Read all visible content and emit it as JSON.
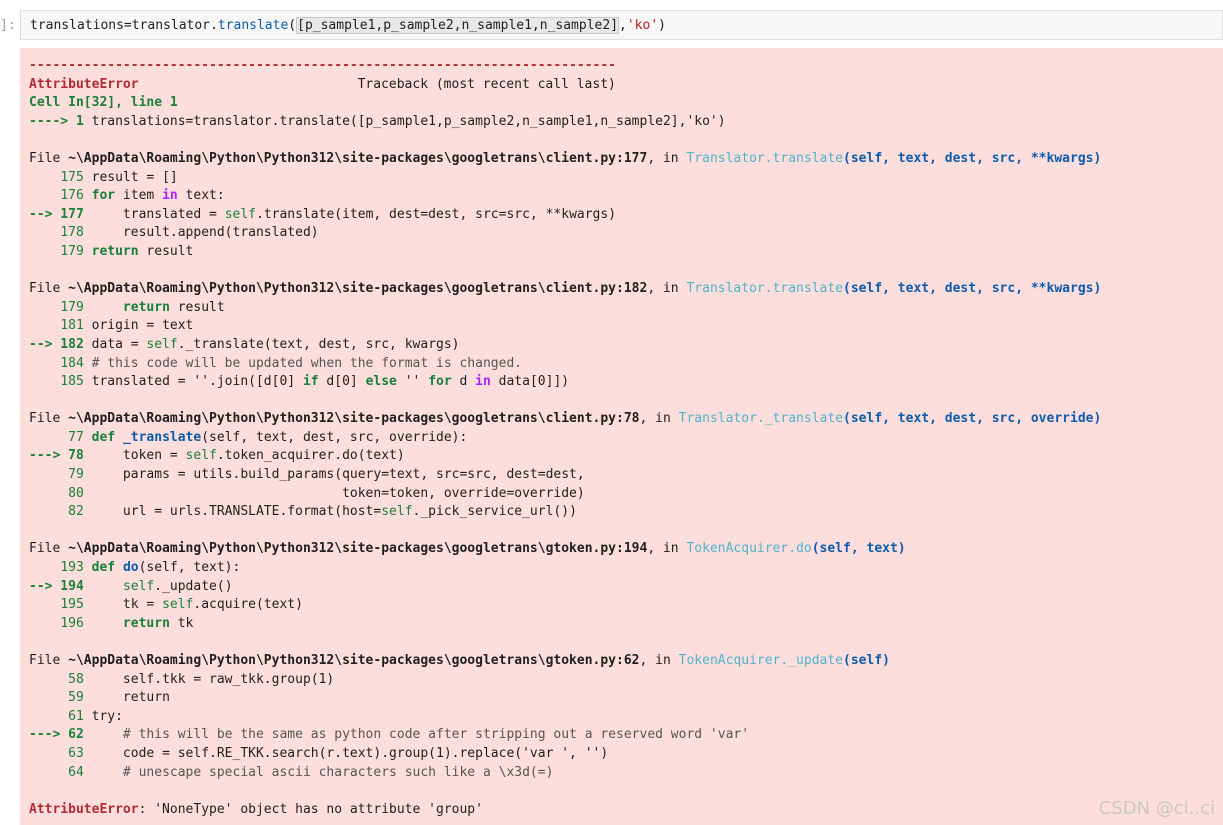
{
  "prompt": "]:",
  "input": {
    "prefix": "translations=translator.",
    "method": "translate",
    "open": "(",
    "highlighted_list": "[p_sample1,p_sample2,n_sample1,n_sample2]",
    "sep": ",",
    "arg": "'ko'",
    "close": ")"
  },
  "traceback": {
    "dashes": "---------------------------------------------------------------------------",
    "error_name": "AttributeError",
    "header_right": "Traceback (most recent call last)",
    "cell_prefix": "Cell ",
    "cell_ref": "In[32], line 1",
    "first_arrow": "----> 1 ",
    "first_code": "translations=translator.translate([p_sample1,p_sample2,n_sample1,n_sample2],'ko')",
    "frames": [
      {
        "file": "~\\AppData\\Roaming\\Python\\Python312\\site-packages\\googletrans\\client.py:177",
        "in_text": ", in ",
        "func": "Translator.translate",
        "args": "(self, text, dest, src, **kwargs)",
        "lines": [
          {
            "num": "175",
            "code": "result = []"
          },
          {
            "num": "176",
            "kw": "for",
            "code": " item ",
            "kw2": "in",
            "code2": " text:"
          },
          {
            "arrow": "--> 177",
            "code": "    translated = ",
            "self": "self",
            "code2": ".translate(item, dest=dest, src=src, **kwargs)"
          },
          {
            "num": "178",
            "code": "    result.append(translated)"
          },
          {
            "num": "179",
            "kw": "return",
            "code": " result"
          }
        ]
      },
      {
        "file": "~\\AppData\\Roaming\\Python\\Python312\\site-packages\\googletrans\\client.py:182",
        "in_text": ", in ",
        "func": "Translator.translate",
        "args": "(self, text, dest, src, **kwargs)",
        "lines": [
          {
            "num": "179",
            "kw": "    return",
            "code": " result"
          },
          {
            "num": "181",
            "code": "origin = text"
          },
          {
            "arrow": "--> 182",
            "code": "data = ",
            "self": "self",
            "code2": "._translate(text, dest, src, kwargs)"
          },
          {
            "num": "184",
            "comment": "# this code will be updated when the format is changed."
          },
          {
            "num": "185",
            "code": "translated = ''.join([d[0] ",
            "kw": "if",
            "code2": " d[0] ",
            "kw2": "else",
            "code3": " '' ",
            "kw3": "for",
            "code4": " d ",
            "kw4": "in",
            "code5": " data[0]])"
          }
        ]
      },
      {
        "file": "~\\AppData\\Roaming\\Python\\Python312\\site-packages\\googletrans\\client.py:78",
        "in_text": ", in ",
        "func": "Translator._translate",
        "args": "(self, text, dest, src, override)",
        "lines": [
          {
            "num": "77",
            "kw": "def",
            "sp": " ",
            "fn": "_translate",
            "code": "(self, text, dest, src, override):"
          },
          {
            "arrow": "---> 78",
            "code": "    token = ",
            "self": "self",
            "code2": ".token_acquirer.do(text)"
          },
          {
            "num": "79",
            "code": "    params = utils.build_params(query=text, src=src, dest=dest,"
          },
          {
            "num": "80",
            "code": "                                token=token, override=override)"
          },
          {
            "num": "82",
            "code": "    url = urls.TRANSLATE.format(host=",
            "self": "self",
            "code2": "._pick_service_url())"
          }
        ]
      },
      {
        "file": "~\\AppData\\Roaming\\Python\\Python312\\site-packages\\googletrans\\gtoken.py:194",
        "in_text": ", in ",
        "func": "TokenAcquirer.do",
        "args": "(self, text)",
        "lines": [
          {
            "num": "193",
            "kw": "def",
            "sp": " ",
            "fn": "do",
            "code": "(self, text):"
          },
          {
            "arrow": "--> 194",
            "code": "    ",
            "self": "self",
            "code2": "._update()"
          },
          {
            "num": "195",
            "code": "    tk = ",
            "self": "self",
            "code2": ".acquire(text)"
          },
          {
            "num": "196",
            "kw": "    return",
            "code": " tk"
          }
        ]
      },
      {
        "file": "~\\AppData\\Roaming\\Python\\Python312\\site-packages\\googletrans\\gtoken.py:62",
        "in_text": ", in ",
        "func": "TokenAcquirer._update",
        "args": "(self)",
        "lines": [
          {
            "num": "58",
            "code": "    self.tkk = raw_tkk.group(1)"
          },
          {
            "num": "59",
            "code": "    return"
          },
          {
            "num": "61",
            "code": "try:"
          },
          {
            "arrow": "---> 62",
            "comment": "    # this will be the same as python code after stripping out a reserved word 'var'"
          },
          {
            "num": "63",
            "code": "    code = self.RE_TKK.search(r.text).group(1).replace('var ', '')"
          },
          {
            "num": "64",
            "comment": "    # unescape special ascii characters such like a \\x3d(=)"
          }
        ]
      }
    ],
    "final_error_name": "AttributeError",
    "final_message": ": 'NoneType' object has no attribute 'group'"
  },
  "watermark": "CSDN @ci..ci"
}
